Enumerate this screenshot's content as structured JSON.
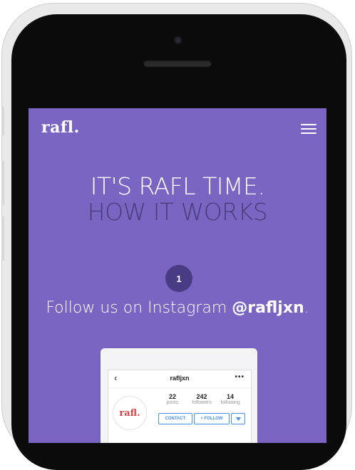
{
  "app": {
    "logo": "rafl.",
    "menu_icon": "hamburger-icon"
  },
  "hero": {
    "line1": "IT'S RAFL TIME.",
    "line2": "HOW IT WORKS"
  },
  "step": {
    "number": "1",
    "text_prefix": "Follow us on Instagram ",
    "handle": "@rafljxn",
    "text_suffix": "."
  },
  "instagram": {
    "back_icon": "chevron-left-icon",
    "username": "rafljxn",
    "more_icon": "more-dots-icon",
    "avatar_text": "rafl.",
    "stats": [
      {
        "value": "22",
        "label": "posts"
      },
      {
        "value": "242",
        "label": "followers"
      },
      {
        "value": "14",
        "label": "following"
      }
    ],
    "contact_label": "CONTACT",
    "follow_label": "+ FOLLOW",
    "dropdown_icon": "caret-down-icon"
  },
  "colors": {
    "screen_bg": "#7a66c2",
    "step_circle": "#4a3b85",
    "headline_dim": "#4a3c7a",
    "ig_blue": "#4a90e2"
  }
}
